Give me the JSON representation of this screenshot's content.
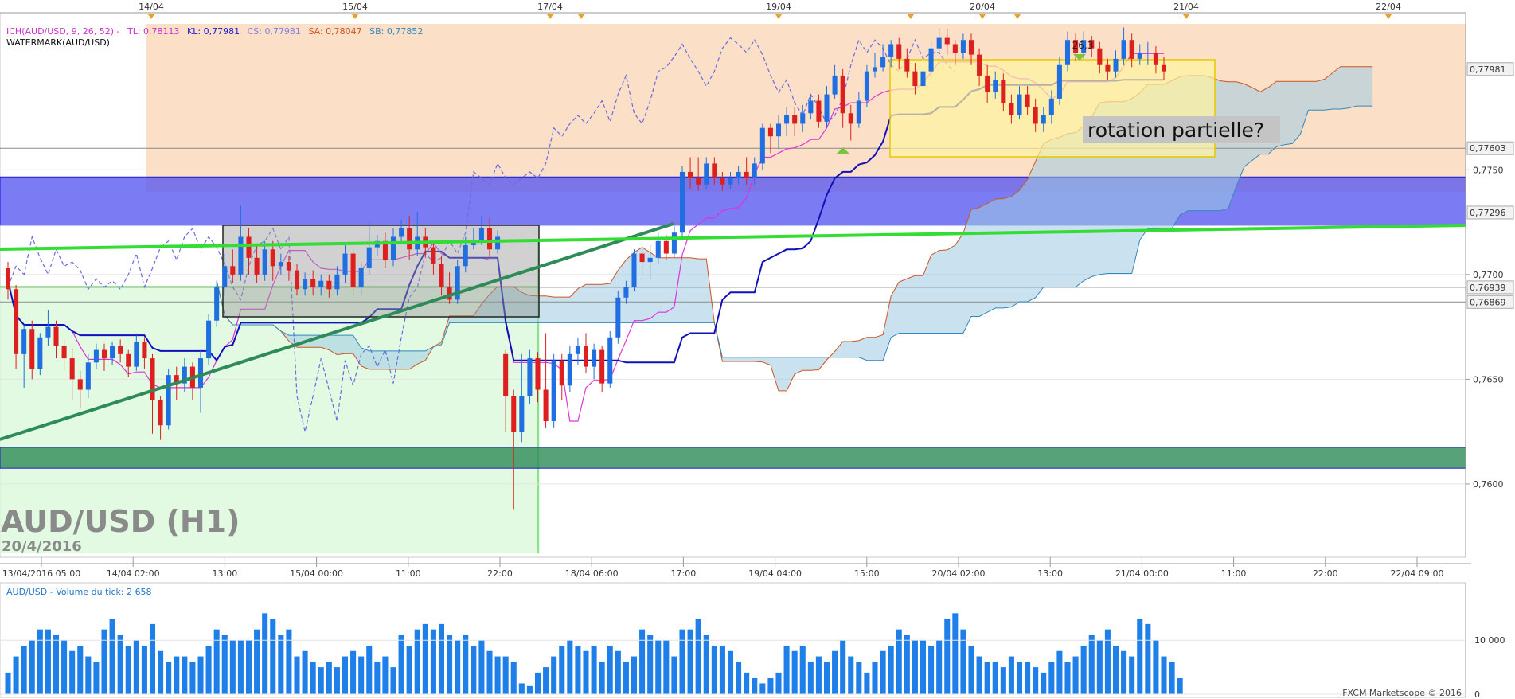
{
  "chart_data": {
    "type": "candlestick",
    "instrument_title": "AUD/USD (H1)",
    "date_label": "20/4/2016",
    "indicator_legend": {
      "ich": "ICH(AUD/USD, 9, 26, 52) -",
      "tl": "TL: 0,78113",
      "kl": "KL: 0,77981",
      "cs": "CS: 0,77981",
      "sa": "SA: 0,78047",
      "sb": "SB: 0,77852",
      "watermark": "WATERMARK(AUD/USD)"
    },
    "volume_legend": "AUD/USD - Volume du tick: 2 658",
    "copyright": "FXCM Marketscope © 2016",
    "annotation": "rotation partielle?",
    "peak_label": "26,3",
    "top_dates": [
      "14/04",
      "15/04",
      "17/04",
      "19/04",
      "20/04",
      "21/04",
      "22/04"
    ],
    "time_ticks": [
      "13/04/2016 05:00",
      "14/04 02:00",
      "13:00",
      "15/04 00:00",
      "11:00",
      "22:00",
      "18/04 06:00",
      "17:00",
      "19/04 04:00",
      "15:00",
      "20/04 02:00",
      "13:00",
      "21/04 00:00",
      "11:00",
      "22:00",
      "22/04 09:00"
    ],
    "y_ticks": [
      "0,7750",
      "0,7700",
      "0,7650",
      "0,7600"
    ],
    "price_labels": [
      "0,77981",
      "0,77603",
      "0,77296",
      "0,76939",
      "0,76869"
    ],
    "volume_ticks": [
      "10 000",
      "0"
    ],
    "ylim": [
      0.7565,
      0.7825
    ],
    "volume_ylim": [
      0,
      18000
    ],
    "horizontal_levels": [
      0.77603,
      0.76939,
      0.76869
    ],
    "zones": [
      {
        "name": "resistance-zone",
        "from": 0.77236,
        "to": 0.77466,
        "color": "#5a5af0"
      },
      {
        "name": "support-zone",
        "from": 0.76075,
        "to": 0.76175,
        "color": "#2e8b57"
      }
    ],
    "candles": [
      {
        "o": 0.7703,
        "c": 0.7693,
        "h": 0.7706,
        "l": 0.7688
      },
      {
        "o": 0.7693,
        "c": 0.7662,
        "h": 0.7695,
        "l": 0.7655
      },
      {
        "o": 0.7662,
        "c": 0.7674,
        "h": 0.7676,
        "l": 0.7646
      },
      {
        "o": 0.7674,
        "c": 0.7655,
        "h": 0.7678,
        "l": 0.765
      },
      {
        "o": 0.7655,
        "c": 0.767,
        "h": 0.7672,
        "l": 0.7652
      },
      {
        "o": 0.767,
        "c": 0.7675,
        "h": 0.7683,
        "l": 0.7666
      },
      {
        "o": 0.7675,
        "c": 0.7666,
        "h": 0.7678,
        "l": 0.766
      },
      {
        "o": 0.7666,
        "c": 0.766,
        "h": 0.7669,
        "l": 0.7654
      },
      {
        "o": 0.766,
        "c": 0.765,
        "h": 0.7665,
        "l": 0.764
      },
      {
        "o": 0.765,
        "c": 0.7645,
        "h": 0.7654,
        "l": 0.7636
      },
      {
        "o": 0.7645,
        "c": 0.7658,
        "h": 0.7662,
        "l": 0.7641
      },
      {
        "o": 0.7658,
        "c": 0.7664,
        "h": 0.7667,
        "l": 0.7655
      },
      {
        "o": 0.7664,
        "c": 0.766,
        "h": 0.7667,
        "l": 0.7654
      },
      {
        "o": 0.766,
        "c": 0.7666,
        "h": 0.7668,
        "l": 0.7657
      },
      {
        "o": 0.7666,
        "c": 0.7662,
        "h": 0.7669,
        "l": 0.7658
      },
      {
        "o": 0.7662,
        "c": 0.7656,
        "h": 0.7664,
        "l": 0.7651
      },
      {
        "o": 0.7656,
        "c": 0.7668,
        "h": 0.7671,
        "l": 0.7654
      },
      {
        "o": 0.7668,
        "c": 0.766,
        "h": 0.767,
        "l": 0.7655
      },
      {
        "o": 0.766,
        "c": 0.764,
        "h": 0.7662,
        "l": 0.7624
      },
      {
        "o": 0.764,
        "c": 0.7628,
        "h": 0.7642,
        "l": 0.7621
      },
      {
        "o": 0.7628,
        "c": 0.7652,
        "h": 0.7655,
        "l": 0.7626
      },
      {
        "o": 0.7652,
        "c": 0.7648,
        "h": 0.7656,
        "l": 0.764
      },
      {
        "o": 0.7648,
        "c": 0.7656,
        "h": 0.766,
        "l": 0.7644
      },
      {
        "o": 0.7656,
        "c": 0.7646,
        "h": 0.7658,
        "l": 0.764
      },
      {
        "o": 0.7646,
        "c": 0.766,
        "h": 0.7664,
        "l": 0.7634
      },
      {
        "o": 0.766,
        "c": 0.7678,
        "h": 0.7681,
        "l": 0.7657
      },
      {
        "o": 0.7678,
        "c": 0.7694,
        "h": 0.7697,
        "l": 0.7675
      },
      {
        "o": 0.7694,
        "c": 0.7704,
        "h": 0.771,
        "l": 0.769
      },
      {
        "o": 0.7704,
        "c": 0.77,
        "h": 0.7712,
        "l": 0.7696
      },
      {
        "o": 0.77,
        "c": 0.7718,
        "h": 0.7733,
        "l": 0.7697
      },
      {
        "o": 0.7718,
        "c": 0.7708,
        "h": 0.7722,
        "l": 0.77
      },
      {
        "o": 0.7708,
        "c": 0.77,
        "h": 0.7714,
        "l": 0.7696
      },
      {
        "o": 0.77,
        "c": 0.7712,
        "h": 0.7716,
        "l": 0.7697
      },
      {
        "o": 0.7712,
        "c": 0.7704,
        "h": 0.7716,
        "l": 0.7697
      },
      {
        "o": 0.7704,
        "c": 0.7706,
        "h": 0.771,
        "l": 0.77
      },
      {
        "o": 0.7706,
        "c": 0.7702,
        "h": 0.7709,
        "l": 0.7697
      },
      {
        "o": 0.7702,
        "c": 0.7693,
        "h": 0.7705,
        "l": 0.769
      },
      {
        "o": 0.7693,
        "c": 0.7698,
        "h": 0.7701,
        "l": 0.769
      },
      {
        "o": 0.7698,
        "c": 0.7694,
        "h": 0.7702,
        "l": 0.769
      },
      {
        "o": 0.7694,
        "c": 0.7697,
        "h": 0.77,
        "l": 0.769
      },
      {
        "o": 0.7697,
        "c": 0.7693,
        "h": 0.77,
        "l": 0.7689
      },
      {
        "o": 0.7693,
        "c": 0.77,
        "h": 0.7704,
        "l": 0.769
      },
      {
        "o": 0.77,
        "c": 0.771,
        "h": 0.7714,
        "l": 0.7696
      },
      {
        "o": 0.771,
        "c": 0.7694,
        "h": 0.7712,
        "l": 0.769
      },
      {
        "o": 0.7694,
        "c": 0.7703,
        "h": 0.7706,
        "l": 0.769
      },
      {
        "o": 0.7703,
        "c": 0.7713,
        "h": 0.7725,
        "l": 0.77
      },
      {
        "o": 0.7713,
        "c": 0.7716,
        "h": 0.7719,
        "l": 0.7709
      },
      {
        "o": 0.7716,
        "c": 0.7707,
        "h": 0.772,
        "l": 0.7703
      },
      {
        "o": 0.7707,
        "c": 0.7718,
        "h": 0.7722,
        "l": 0.7704
      },
      {
        "o": 0.7718,
        "c": 0.7722,
        "h": 0.7726,
        "l": 0.7715
      },
      {
        "o": 0.7722,
        "c": 0.7712,
        "h": 0.7728,
        "l": 0.7707
      },
      {
        "o": 0.7712,
        "c": 0.7718,
        "h": 0.773,
        "l": 0.7709
      },
      {
        "o": 0.7718,
        "c": 0.7713,
        "h": 0.7722,
        "l": 0.7708
      },
      {
        "o": 0.7713,
        "c": 0.7705,
        "h": 0.7716,
        "l": 0.77
      },
      {
        "o": 0.7705,
        "c": 0.7694,
        "h": 0.7709,
        "l": 0.769
      },
      {
        "o": 0.7694,
        "c": 0.7688,
        "h": 0.7701,
        "l": 0.7686
      },
      {
        "o": 0.7688,
        "c": 0.7704,
        "h": 0.7707,
        "l": 0.7686
      },
      {
        "o": 0.7704,
        "c": 0.7714,
        "h": 0.7718,
        "l": 0.7701
      },
      {
        "o": 0.7714,
        "c": 0.7716,
        "h": 0.7722,
        "l": 0.7712
      },
      {
        "o": 0.7716,
        "c": 0.7722,
        "h": 0.7728,
        "l": 0.7714
      },
      {
        "o": 0.7722,
        "c": 0.7712,
        "h": 0.7727,
        "l": 0.7708
      },
      {
        "o": 0.7712,
        "c": 0.7718,
        "h": 0.7721,
        "l": 0.771
      },
      {
        "o": 0.7662,
        "c": 0.7642,
        "h": 0.7664,
        "l": 0.7625
      },
      {
        "o": 0.7642,
        "c": 0.7625,
        "h": 0.7645,
        "l": 0.7588
      },
      {
        "o": 0.7625,
        "c": 0.7642,
        "h": 0.7662,
        "l": 0.762
      },
      {
        "o": 0.7642,
        "c": 0.766,
        "h": 0.7664,
        "l": 0.7638
      },
      {
        "o": 0.766,
        "c": 0.7645,
        "h": 0.7663,
        "l": 0.7639
      },
      {
        "o": 0.7645,
        "c": 0.763,
        "h": 0.7672,
        "l": 0.7627
      },
      {
        "o": 0.763,
        "c": 0.7659,
        "h": 0.7662,
        "l": 0.7627
      },
      {
        "o": 0.7659,
        "c": 0.7647,
        "h": 0.7662,
        "l": 0.764
      },
      {
        "o": 0.7647,
        "c": 0.7662,
        "h": 0.7666,
        "l": 0.7644
      },
      {
        "o": 0.7662,
        "c": 0.7666,
        "h": 0.767,
        "l": 0.7657
      },
      {
        "o": 0.7666,
        "c": 0.7656,
        "h": 0.7672,
        "l": 0.7653
      },
      {
        "o": 0.7656,
        "c": 0.7664,
        "h": 0.7667,
        "l": 0.765
      },
      {
        "o": 0.7664,
        "c": 0.7648,
        "h": 0.7666,
        "l": 0.7644
      },
      {
        "o": 0.7648,
        "c": 0.767,
        "h": 0.7673,
        "l": 0.7646
      },
      {
        "o": 0.767,
        "c": 0.7689,
        "h": 0.7692,
        "l": 0.7667
      },
      {
        "o": 0.7689,
        "c": 0.7694,
        "h": 0.7697,
        "l": 0.7686
      },
      {
        "o": 0.7694,
        "c": 0.771,
        "h": 0.7712,
        "l": 0.7692
      },
      {
        "o": 0.771,
        "c": 0.7706,
        "h": 0.7712,
        "l": 0.77
      },
      {
        "o": 0.7706,
        "c": 0.7708,
        "h": 0.7714,
        "l": 0.7698
      },
      {
        "o": 0.7708,
        "c": 0.7716,
        "h": 0.772,
        "l": 0.7705
      },
      {
        "o": 0.7716,
        "c": 0.771,
        "h": 0.7719,
        "l": 0.7707
      },
      {
        "o": 0.771,
        "c": 0.772,
        "h": 0.7723,
        "l": 0.7708
      },
      {
        "o": 0.772,
        "c": 0.7749,
        "h": 0.7752,
        "l": 0.7717
      },
      {
        "o": 0.7749,
        "c": 0.7746,
        "h": 0.7756,
        "l": 0.7741
      },
      {
        "o": 0.7746,
        "c": 0.7743,
        "h": 0.7756,
        "l": 0.774
      },
      {
        "o": 0.7743,
        "c": 0.7753,
        "h": 0.7756,
        "l": 0.7741
      },
      {
        "o": 0.7753,
        "c": 0.7746,
        "h": 0.7756,
        "l": 0.7743
      },
      {
        "o": 0.7746,
        "c": 0.7743,
        "h": 0.7749,
        "l": 0.774
      },
      {
        "o": 0.7743,
        "c": 0.7746,
        "h": 0.7749,
        "l": 0.7741
      },
      {
        "o": 0.7746,
        "c": 0.7749,
        "h": 0.7752,
        "l": 0.7743
      },
      {
        "o": 0.7749,
        "c": 0.7746,
        "h": 0.7756,
        "l": 0.7743
      },
      {
        "o": 0.7746,
        "c": 0.7753,
        "h": 0.7756,
        "l": 0.7743
      },
      {
        "o": 0.7753,
        "c": 0.777,
        "h": 0.7772,
        "l": 0.775
      },
      {
        "o": 0.777,
        "c": 0.7766,
        "h": 0.7772,
        "l": 0.7758
      },
      {
        "o": 0.7766,
        "c": 0.7772,
        "h": 0.7776,
        "l": 0.776
      },
      {
        "o": 0.7772,
        "c": 0.7776,
        "h": 0.778,
        "l": 0.7766
      },
      {
        "o": 0.7776,
        "c": 0.7772,
        "h": 0.778,
        "l": 0.7766
      },
      {
        "o": 0.7772,
        "c": 0.7777,
        "h": 0.7781,
        "l": 0.7768
      },
      {
        "o": 0.7777,
        "c": 0.7783,
        "h": 0.7786,
        "l": 0.7774
      },
      {
        "o": 0.7783,
        "c": 0.7773,
        "h": 0.7786,
        "l": 0.777
      },
      {
        "o": 0.7773,
        "c": 0.7786,
        "h": 0.779,
        "l": 0.777
      },
      {
        "o": 0.7786,
        "c": 0.7795,
        "h": 0.78,
        "l": 0.7784
      },
      {
        "o": 0.7795,
        "c": 0.7777,
        "h": 0.7798,
        "l": 0.777
      },
      {
        "o": 0.7777,
        "c": 0.7772,
        "h": 0.7781,
        "l": 0.7764
      },
      {
        "o": 0.7772,
        "c": 0.7783,
        "h": 0.7787,
        "l": 0.777
      },
      {
        "o": 0.7783,
        "c": 0.7797,
        "h": 0.78,
        "l": 0.778
      },
      {
        "o": 0.7797,
        "c": 0.7799,
        "h": 0.7806,
        "l": 0.7794
      },
      {
        "o": 0.7799,
        "c": 0.7804,
        "h": 0.781,
        "l": 0.7797
      },
      {
        "o": 0.7804,
        "c": 0.781,
        "h": 0.7812,
        "l": 0.7799
      },
      {
        "o": 0.781,
        "c": 0.7803,
        "h": 0.7813,
        "l": 0.7798
      },
      {
        "o": 0.7803,
        "c": 0.7797,
        "h": 0.7808,
        "l": 0.7794
      },
      {
        "o": 0.7797,
        "c": 0.779,
        "h": 0.7801,
        "l": 0.7786
      },
      {
        "o": 0.779,
        "c": 0.7797,
        "h": 0.78,
        "l": 0.7788
      },
      {
        "o": 0.7797,
        "c": 0.7808,
        "h": 0.7812,
        "l": 0.7794
      },
      {
        "o": 0.7808,
        "c": 0.7813,
        "h": 0.7817,
        "l": 0.7806
      },
      {
        "o": 0.7813,
        "c": 0.781,
        "h": 0.7817,
        "l": 0.7805
      },
      {
        "o": 0.781,
        "c": 0.7806,
        "h": 0.7812,
        "l": 0.78
      },
      {
        "o": 0.7806,
        "c": 0.7812,
        "h": 0.7815,
        "l": 0.7803
      },
      {
        "o": 0.7812,
        "c": 0.7805,
        "h": 0.7815,
        "l": 0.78
      },
      {
        "o": 0.7805,
        "c": 0.7795,
        "h": 0.7808,
        "l": 0.779
      },
      {
        "o": 0.7795,
        "c": 0.7787,
        "h": 0.78,
        "l": 0.7782
      },
      {
        "o": 0.7787,
        "c": 0.7793,
        "h": 0.7797,
        "l": 0.7784
      },
      {
        "o": 0.7793,
        "c": 0.7782,
        "h": 0.7796,
        "l": 0.7778
      },
      {
        "o": 0.7782,
        "c": 0.7776,
        "h": 0.7786,
        "l": 0.7772
      },
      {
        "o": 0.7776,
        "c": 0.7786,
        "h": 0.779,
        "l": 0.7774
      },
      {
        "o": 0.7786,
        "c": 0.778,
        "h": 0.779,
        "l": 0.7776
      },
      {
        "o": 0.778,
        "c": 0.7772,
        "h": 0.7784,
        "l": 0.7768
      },
      {
        "o": 0.7772,
        "c": 0.7776,
        "h": 0.778,
        "l": 0.7768
      },
      {
        "o": 0.7776,
        "c": 0.7784,
        "h": 0.7788,
        "l": 0.7772
      },
      {
        "o": 0.7784,
        "c": 0.78,
        "h": 0.7804,
        "l": 0.7781
      },
      {
        "o": 0.78,
        "c": 0.7812,
        "h": 0.7816,
        "l": 0.7797
      },
      {
        "o": 0.7812,
        "c": 0.7806,
        "h": 0.7815,
        "l": 0.7802
      },
      {
        "o": 0.7806,
        "c": 0.7812,
        "h": 0.7816,
        "l": 0.7803
      },
      {
        "o": 0.7812,
        "c": 0.7808,
        "h": 0.7814,
        "l": 0.7804
      },
      {
        "o": 0.7808,
        "c": 0.78,
        "h": 0.7811,
        "l": 0.7796
      },
      {
        "o": 0.78,
        "c": 0.7797,
        "h": 0.7803,
        "l": 0.7793
      },
      {
        "o": 0.7797,
        "c": 0.7803,
        "h": 0.7807,
        "l": 0.7794
      },
      {
        "o": 0.7803,
        "c": 0.7812,
        "h": 0.7818,
        "l": 0.78
      },
      {
        "o": 0.7812,
        "c": 0.7803,
        "h": 0.7815,
        "l": 0.7799
      },
      {
        "o": 0.7803,
        "c": 0.7806,
        "h": 0.781,
        "l": 0.78
      },
      {
        "o": 0.7806,
        "c": 0.7806,
        "h": 0.7811,
        "l": 0.78
      },
      {
        "o": 0.7806,
        "c": 0.78,
        "h": 0.7809,
        "l": 0.7796
      },
      {
        "o": 0.78,
        "c": 0.7797,
        "h": 0.7804,
        "l": 0.7793
      }
    ],
    "volumes": [
      4000,
      7000,
      9000,
      10000,
      12000,
      12000,
      11000,
      10000,
      8000,
      9000,
      7000,
      6000,
      12000,
      14000,
      11000,
      9000,
      10000,
      9000,
      13000,
      8000,
      6000,
      7000,
      7000,
      6000,
      7000,
      9000,
      12000,
      11000,
      10000,
      10000,
      10000,
      12000,
      15000,
      14000,
      11000,
      12000,
      7000,
      8000,
      6000,
      5000,
      6000,
      5000,
      7000,
      8000,
      7000,
      9000,
      6000,
      7000,
      5000,
      11000,
      9000,
      12000,
      13000,
      12000,
      13000,
      11000,
      10000,
      11000,
      9000,
      10000,
      8000,
      7000,
      7000,
      6000,
      2000,
      1500,
      4000,
      5000,
      7000,
      9000,
      10000,
      9000,
      8000,
      9000,
      6000,
      9000,
      8000,
      6000,
      7000,
      12000,
      11000,
      10000,
      10000,
      7000,
      12000,
      12000,
      14000,
      11000,
      9000,
      9000,
      8000,
      6000,
      4000,
      3000,
      2000,
      3000,
      4000,
      9000,
      8000,
      9000,
      6000,
      7000,
      6000,
      8000,
      10000,
      7000,
      6000,
      4000,
      6000,
      8000,
      9000,
      12000,
      11000,
      10000,
      10000,
      9000,
      10000,
      14000,
      15000,
      12000,
      9000,
      7000,
      6000,
      6000,
      5000,
      7000,
      6000,
      6000,
      5000,
      4000,
      6000,
      8000,
      6000,
      7000,
      9000,
      11000,
      10000,
      12000,
      9000,
      8000,
      7000,
      14000,
      13000,
      10000,
      7000,
      6000,
      3000
    ]
  }
}
